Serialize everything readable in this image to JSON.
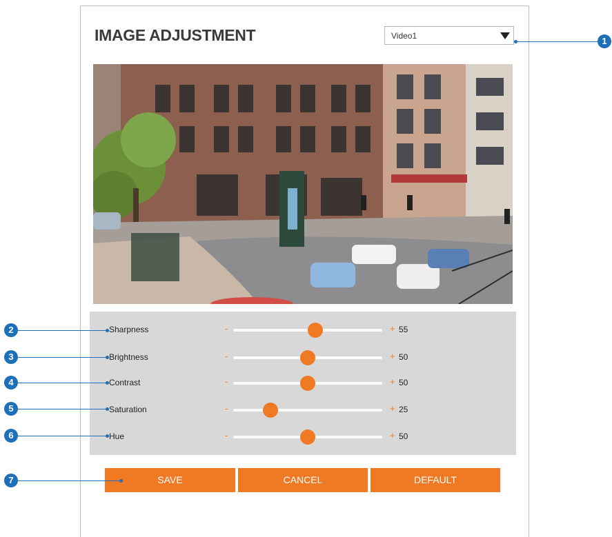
{
  "title": "IMAGE ADJUSTMENT",
  "video_select": {
    "value": "Video1"
  },
  "callouts": [
    "1",
    "2",
    "3",
    "4",
    "5",
    "6",
    "7"
  ],
  "sliders": [
    {
      "label": "Sharpness",
      "minus": "-",
      "plus": "+",
      "value": "55",
      "fraction": 0.55
    },
    {
      "label": "Brightness",
      "minus": "-",
      "plus": "+",
      "value": "50",
      "fraction": 0.5
    },
    {
      "label": "Contrast",
      "minus": "-",
      "plus": "+",
      "value": "50",
      "fraction": 0.5
    },
    {
      "label": "Saturation",
      "minus": "-",
      "plus": "+",
      "value": "25",
      "fraction": 0.25
    },
    {
      "label": "Hue",
      "minus": "-",
      "plus": "+",
      "value": "50",
      "fraction": 0.5
    }
  ],
  "buttons": {
    "save": "SAVE",
    "cancel": "CANCEL",
    "default": "DEFAULT"
  },
  "colors": {
    "accent": "#f07a23",
    "callout": "#1c6fb8",
    "slider_panel": "#d8d8d8"
  }
}
